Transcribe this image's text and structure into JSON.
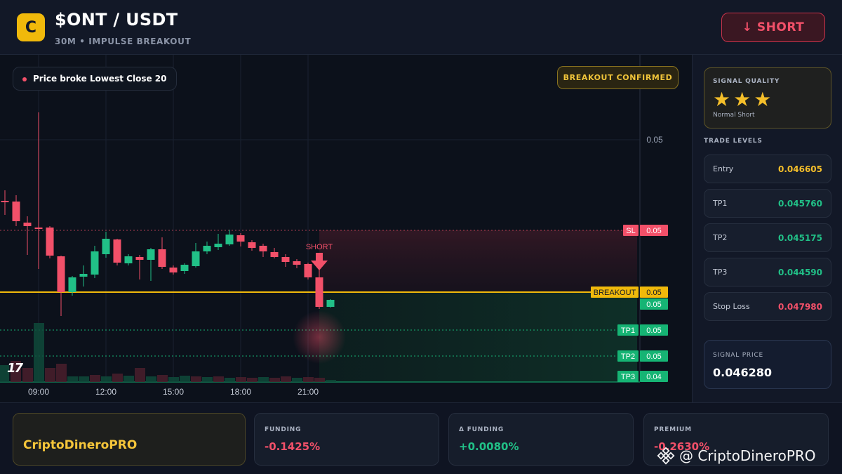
{
  "header": {
    "logo_letter": "C",
    "pair": "$ONT / USDT",
    "subtitle": "30M • IMPULSE BREAKOUT",
    "short_button": "↓ SHORT"
  },
  "chart": {
    "pill_text": "Price broke Lowest Close 20",
    "confirm_badge": "BREAKOUT CONFIRMED",
    "price_axis_label": "0.05",
    "short_marker": "SHORT",
    "tv_logo": "17",
    "time_labels": [
      "09:00",
      "12:00",
      "15:00",
      "18:00",
      "21:00"
    ],
    "level_tags": [
      {
        "name": "SL",
        "value": "0.05",
        "color": "#f25069"
      },
      {
        "name": "BREAKOUT",
        "value": "0.05",
        "color": "#f0b90b"
      },
      {
        "name": "",
        "value": "0.05",
        "color": "#16b474"
      },
      {
        "name": "TP1",
        "value": "0.05",
        "color": "#16b474"
      },
      {
        "name": "TP2",
        "value": "0.05",
        "color": "#16b474"
      },
      {
        "name": "TP3",
        "value": "0.04",
        "color": "#16b474"
      }
    ],
    "colors": {
      "up": "#21c087",
      "down": "#f25069",
      "breakout": "#f0b90b"
    }
  },
  "sidebar": {
    "quality_label": "SIGNAL QUALITY",
    "stars": "★★★",
    "quality_type": "Normal Short",
    "levels_title": "TRADE LEVELS",
    "levels": [
      {
        "label": "Entry",
        "value": "0.046605",
        "color": "#f5bf2a"
      },
      {
        "label": "TP1",
        "value": "0.045760",
        "color": "#21c087"
      },
      {
        "label": "TP2",
        "value": "0.045175",
        "color": "#21c087"
      },
      {
        "label": "TP3",
        "value": "0.044590",
        "color": "#21c087"
      },
      {
        "label": "Stop Loss",
        "value": "0.047980",
        "color": "#f25069"
      }
    ],
    "signal_price_label": "SIGNAL PRICE",
    "signal_price": "0.046280"
  },
  "footer": {
    "brand": "CriptoDineroPRO",
    "stats": [
      {
        "label": "FUNDING",
        "value": "-0.1425%",
        "color": "#f25069"
      },
      {
        "label": "Δ FUNDING",
        "value": "+0.0080%",
        "color": "#21c087"
      },
      {
        "label": "PREMIUM",
        "value": "-0.2630%",
        "color": "#f25069"
      }
    ],
    "watermark": "@ CriptoDineroPRO"
  }
}
